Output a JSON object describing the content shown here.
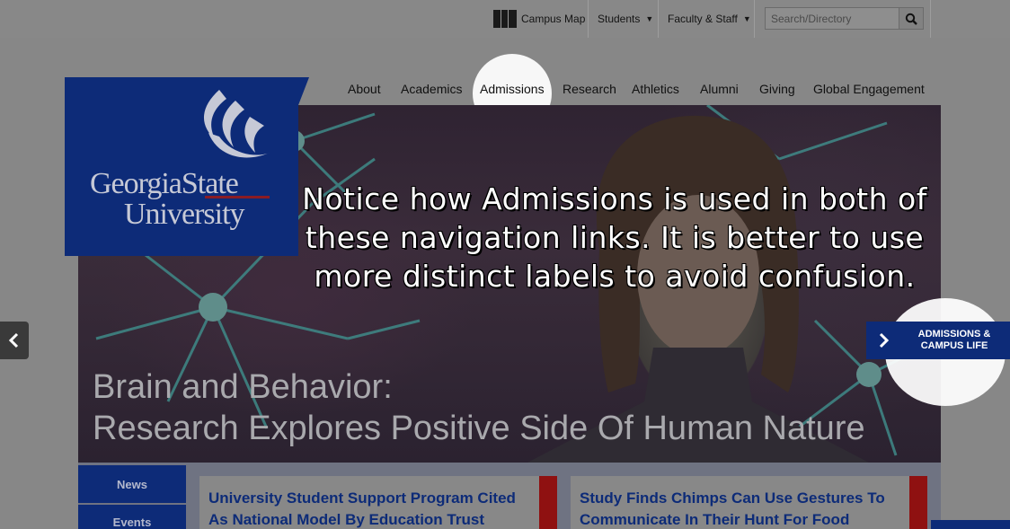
{
  "utility": {
    "campus_map": "Campus Map",
    "students": "Students",
    "faculty_staff": "Faculty & Staff",
    "search_placeholder": "Search/Directory"
  },
  "nav": {
    "items": [
      "About",
      "Academics",
      "Admissions",
      "Research",
      "Athletics",
      "Alumni",
      "Giving",
      "Global Engagement"
    ],
    "highlighted": "Admissions"
  },
  "logo": {
    "line1": "GeorgiaState",
    "line2": "University"
  },
  "annotation": "Notice how Admissions is used in both of these navigation links. It is better to use more distinct labels to avoid confusion.",
  "hero": {
    "headline_line1": "Brain and Behavior:",
    "headline_line2": "Research Explores Positive Side Of Human Nature",
    "next_label_line1": "ADMISSIONS &",
    "next_label_line2": "CAMPUS LIFE"
  },
  "side_tabs": [
    "News",
    "Events"
  ],
  "cards": [
    {
      "title_line1": "University Student Support Program Cited",
      "title_line2": "As National Model By Education Trust"
    },
    {
      "title_line1": "Study Finds Chimps Can Use Gestures To",
      "title_line2": "Communicate In Their Hunt For Food"
    }
  ],
  "colors": {
    "brand_blue": "#0d2b78",
    "accent_red": "#8f1111",
    "overlay_gray": "#878787"
  },
  "icons": {
    "map": "map-icon",
    "search": "search-icon",
    "prev": "chevron-left-icon",
    "next": "chevron-right-icon"
  }
}
